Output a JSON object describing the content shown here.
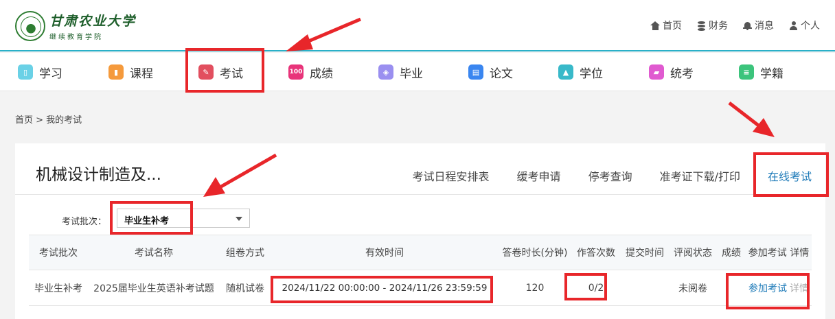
{
  "logo": {
    "cn": "甘肃农业大学",
    "sub": "继续教育学院"
  },
  "topnav": [
    {
      "label": "首页",
      "icon": "home-icon"
    },
    {
      "label": "财务",
      "icon": "database-icon"
    },
    {
      "label": "消息",
      "icon": "bell-icon"
    },
    {
      "label": "个人",
      "icon": "user-icon"
    }
  ],
  "mainnav": [
    {
      "label": "学习",
      "icon": "book-icon",
      "color": "#6ad1e6"
    },
    {
      "label": "课程",
      "icon": "bookmark-icon",
      "color": "#f59a3c"
    },
    {
      "label": "考试",
      "icon": "pen-icon",
      "color": "#e24f5f"
    },
    {
      "label": "成绩",
      "icon": "score-100-icon",
      "color": "#e8347a"
    },
    {
      "label": "毕业",
      "icon": "graduate-icon",
      "color": "#9a8ff0"
    },
    {
      "label": "论文",
      "icon": "paper-icon",
      "color": "#3a86f0"
    },
    {
      "label": "学位",
      "icon": "cap-icon",
      "color": "#38b9c9"
    },
    {
      "label": "统考",
      "icon": "folder-icon",
      "color": "#e05ad0"
    },
    {
      "label": "学籍",
      "icon": "list-icon",
      "color": "#3cc47c"
    }
  ],
  "breadcrumb": "首页 > 我的考试",
  "card": {
    "title": "机械设计制造及...",
    "tabs": [
      "考试日程安排表",
      "缓考申请",
      "停考查询",
      "准考证下载/打印",
      "在线考试"
    ],
    "active_tab": 4
  },
  "filter": {
    "label": "考试批次：",
    "selected": "毕业生补考"
  },
  "table": {
    "headers": [
      "考试批次",
      "考试名称",
      "组卷方式",
      "有效时间",
      "答卷时长(分钟)",
      "作答次数",
      "提交时间",
      "评阅状态",
      "成绩",
      "参加考试 详情"
    ],
    "rows": [
      {
        "batch": "毕业生补考",
        "name": "2025届毕业生英语补考试题",
        "method": "随机试卷",
        "time": "2024/11/22 00:00:00 - 2024/11/26 23:59:59",
        "duration": "120",
        "attempts": "0/2",
        "submit": "",
        "review": "未阅卷",
        "score": "",
        "join": "参加考试",
        "detail": "详情"
      }
    ]
  },
  "colors": {
    "accent": "#1d7ab8",
    "highlight": "#e8262a",
    "topline": "#2ab0c8"
  }
}
